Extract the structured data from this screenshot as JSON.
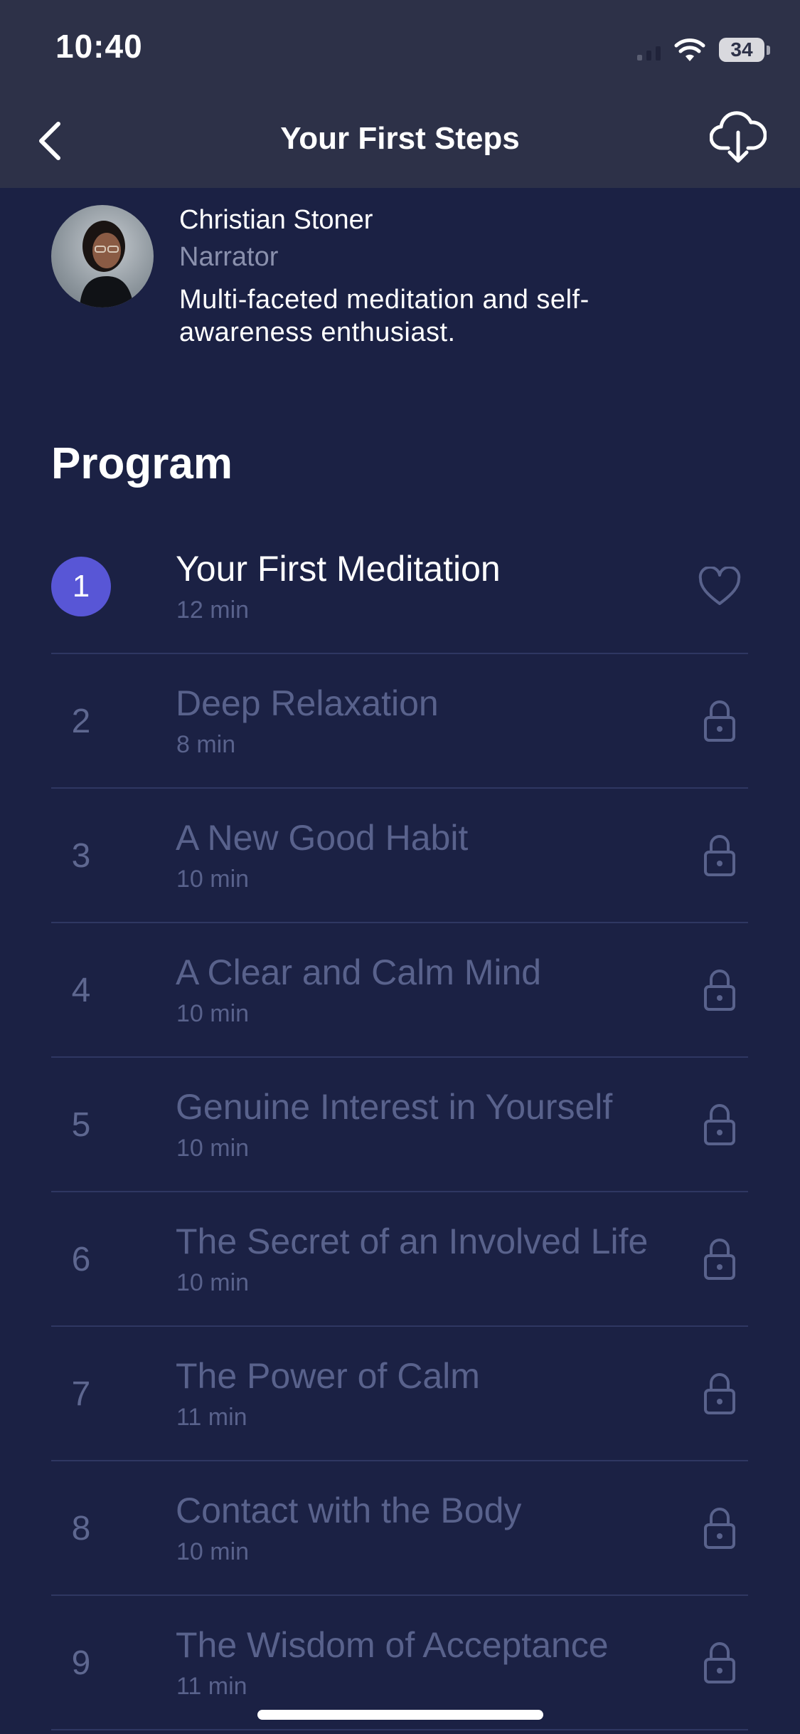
{
  "status_bar": {
    "time": "10:40",
    "battery": "34"
  },
  "nav": {
    "title": "Your First Steps",
    "back_icon": "chevron-left-icon",
    "download_icon": "cloud-download-icon"
  },
  "narrator": {
    "name": "Christian Stoner",
    "role": "Narrator",
    "bio": "Multi-faceted meditation and self-awareness enthusiast."
  },
  "program": {
    "heading": "Program",
    "items": [
      {
        "number": "1",
        "title": "Your First Meditation",
        "duration": "12 min",
        "status": "heart",
        "active": true
      },
      {
        "number": "2",
        "title": "Deep Relaxation",
        "duration": "8 min",
        "status": "lock",
        "active": false
      },
      {
        "number": "3",
        "title": "A New Good Habit",
        "duration": "10 min",
        "status": "lock",
        "active": false
      },
      {
        "number": "4",
        "title": "A Clear and Calm Mind",
        "duration": "10 min",
        "status": "lock",
        "active": false
      },
      {
        "number": "5",
        "title": "Genuine Interest in Yourself",
        "duration": "10 min",
        "status": "lock",
        "active": false
      },
      {
        "number": "6",
        "title": "The Secret of an Involved Life",
        "duration": "10 min",
        "status": "lock",
        "active": false
      },
      {
        "number": "7",
        "title": "The Power of Calm",
        "duration": "11 min",
        "status": "lock",
        "active": false
      },
      {
        "number": "8",
        "title": "Contact with the Body",
        "duration": "10 min",
        "status": "lock",
        "active": false
      },
      {
        "number": "9",
        "title": "The Wisdom of Acceptance",
        "duration": "11 min",
        "status": "lock",
        "active": false
      }
    ]
  },
  "colors": {
    "background": "#1b2144",
    "header": "#2d3148",
    "accent": "#5856d6",
    "muted_text": "#59628c"
  }
}
